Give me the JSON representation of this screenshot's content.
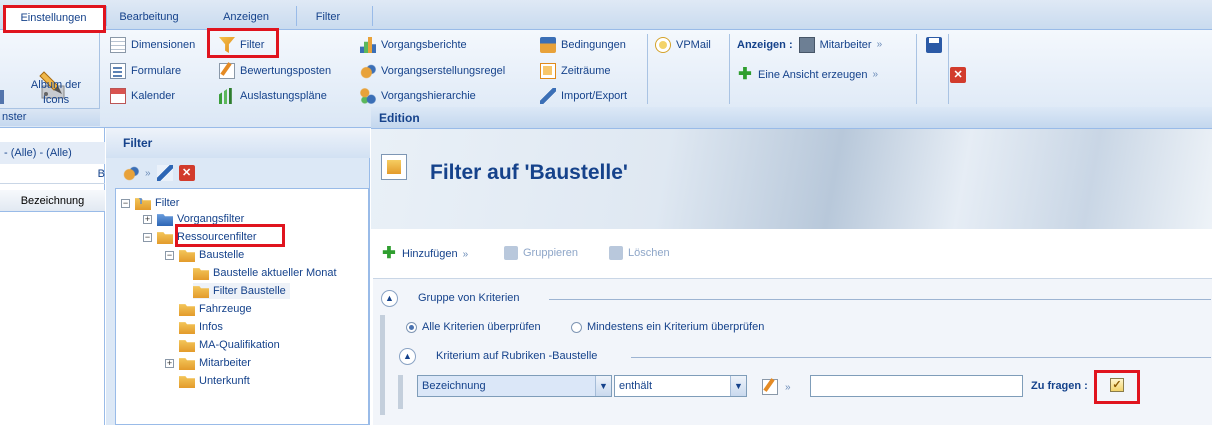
{
  "tabs": [
    {
      "label": "Einstellungen",
      "active": true
    },
    {
      "label": "Bearbeitung",
      "active": false
    },
    {
      "label": "Anzeigen",
      "active": false
    },
    {
      "label": "Filter",
      "active": false
    }
  ],
  "ribbon": {
    "album_label_1": "Album der",
    "album_label_2": "Icons",
    "group_cut_label": "nster",
    "col1": [
      "Dimensionen",
      "Formulare",
      "Kalender"
    ],
    "col2": [
      "Filter",
      "Bewertungsposten",
      "Auslastungspläne"
    ],
    "col3": [
      "Vorgangsberichte",
      "Vorgangserstellungsregel",
      "Vorgangshierarchie"
    ],
    "col4": [
      "Bedingungen",
      "Zeiträume",
      "Import/Export"
    ],
    "vpmail": "VPMail",
    "anzeigen_label": "Anzeigen :",
    "mitarbeiter": "Mitarbeiter",
    "create_view": "Eine Ansicht erzeugen"
  },
  "left_pane": {
    "filter_value": "- (Alle) - (Alle)",
    "col_letter": "B",
    "column_header": "Bezeichnung"
  },
  "filter_panel": {
    "title": "Filter",
    "tree": {
      "root": "Filter",
      "vorgangsfilter": "Vorgangsfilter",
      "ressourcenfilter": "Ressourcenfilter",
      "baustelle": "Baustelle",
      "baustelle_children": [
        "Baustelle aktueller Monat",
        "Filter Baustelle"
      ],
      "siblings": [
        "Fahrzeuge",
        "Infos",
        "MA-Qualifikation",
        "Mitarbeiter",
        "Unterkunft"
      ]
    }
  },
  "edition": {
    "header": "Edition",
    "title": "Filter auf 'Baustelle'",
    "toolbar": {
      "add": "Hinzufügen",
      "group": "Gruppieren",
      "delete": "Löschen"
    },
    "criteria_group_label": "Gruppe von Kriterien",
    "radio_all": "Alle Kriterien überprüfen",
    "radio_any": "Mindestens ein Kriterium überprüfen",
    "criterion_label": "Kriterium auf Rubriken -Baustelle",
    "field_value": "Bezeichnung",
    "operator_value": "enthält",
    "text_value": "",
    "ask_label": "Zu fragen :",
    "ask_checked": true
  },
  "colors": {
    "accent": "#15428b",
    "highlight_box": "#e0141e"
  }
}
